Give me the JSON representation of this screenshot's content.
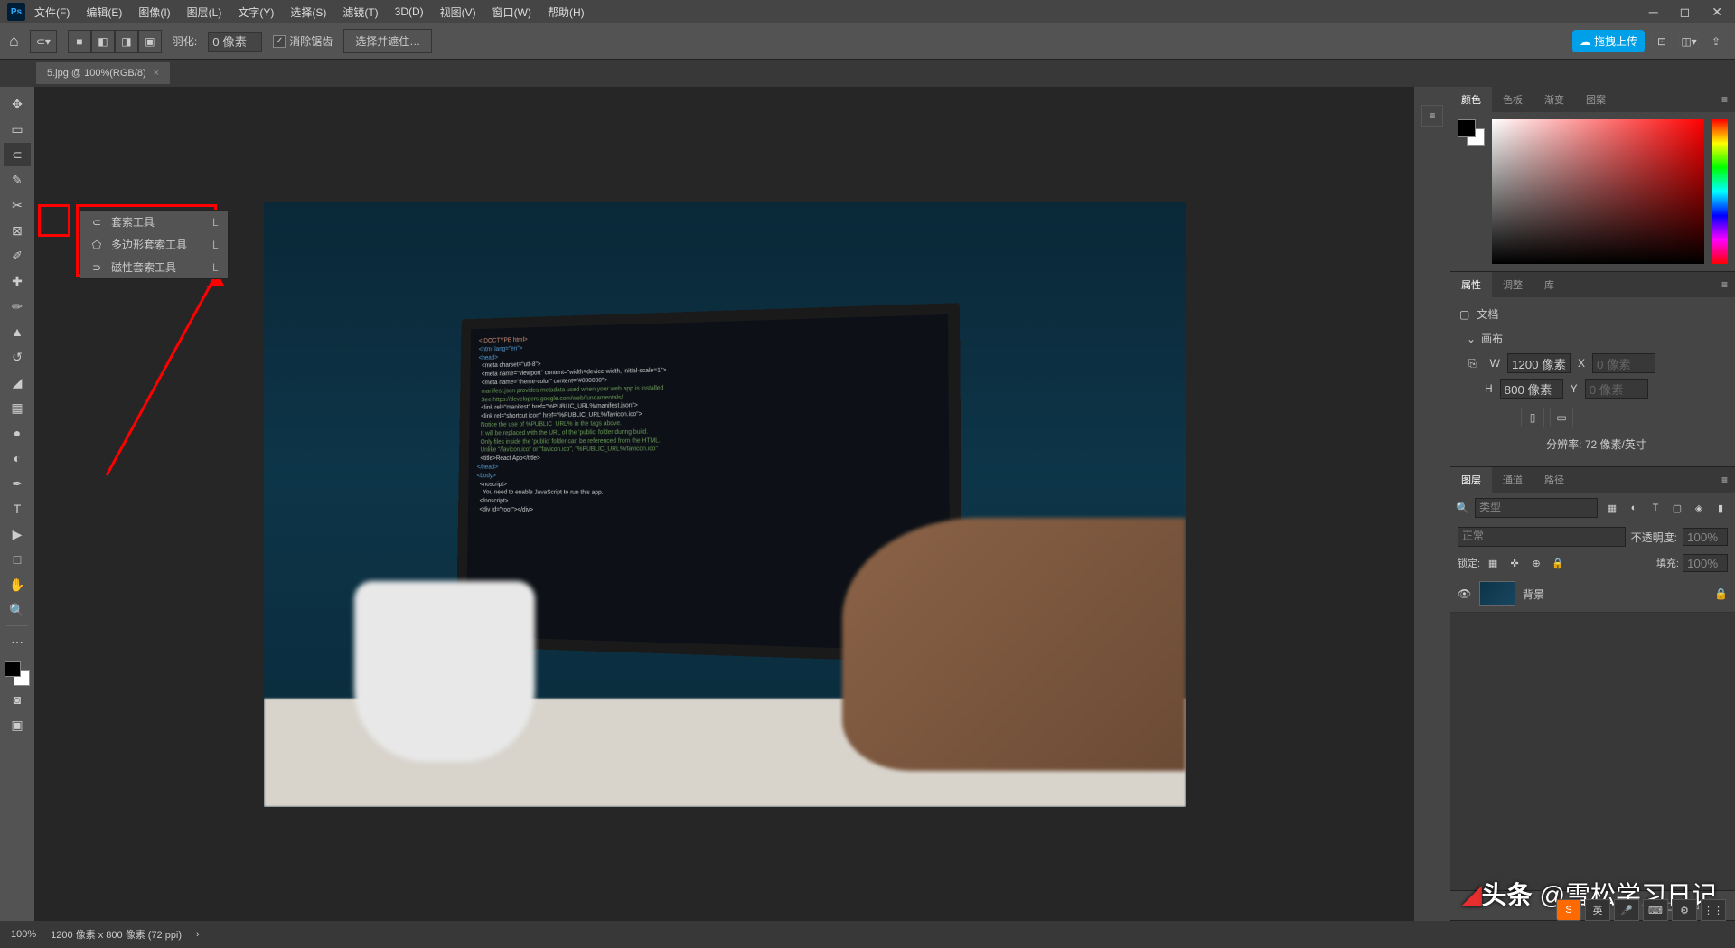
{
  "menu": {
    "file": "文件(F)",
    "edit": "编辑(E)",
    "image": "图像(I)",
    "layer": "图层(L)",
    "type": "文字(Y)",
    "select": "选择(S)",
    "filter": "滤镜(T)",
    "threeD": "3D(D)",
    "view": "视图(V)",
    "window": "窗口(W)",
    "help": "帮助(H)"
  },
  "options": {
    "feather_label": "羽化:",
    "feather_value": "0 像素",
    "antialias": "消除锯齿",
    "select_mask": "选择并遮住…",
    "upload": "拖拽上传"
  },
  "tab": {
    "title": "5.jpg @ 100%(RGB/8)"
  },
  "ctx": [
    {
      "icon": "⊂",
      "name": "套索工具",
      "key": "L"
    },
    {
      "icon": "⬠",
      "name": "多边形套索工具",
      "key": "L"
    },
    {
      "icon": "⊃",
      "name": "磁性套索工具",
      "key": "L"
    }
  ],
  "panels": {
    "color": {
      "tabs": [
        "颜色",
        "色板",
        "渐变",
        "图案"
      ]
    },
    "props": {
      "tabs": [
        "属性",
        "调整",
        "库"
      ],
      "doc": "文档",
      "canvas": "画布",
      "w_label": "W",
      "w_val": "1200 像素",
      "x_label": "X",
      "x_val": "0 像素",
      "h_label": "H",
      "h_val": "800 像素",
      "y_label": "Y",
      "y_val": "0 像素",
      "res": "分辨率: 72 像素/英寸"
    },
    "layers": {
      "tabs": [
        "图层",
        "通道",
        "路径"
      ],
      "search_ph": "类型",
      "blend": "正常",
      "opacity_label": "不透明度:",
      "opacity": "100%",
      "lock_label": "锁定:",
      "fill_label": "填充:",
      "fill": "100%",
      "layer_name": "背景"
    }
  },
  "status": {
    "zoom": "100%",
    "dims": "1200 像素 x 800 像素 (72 ppi)"
  },
  "watermark": {
    "brand": "头条",
    "handle": "@雪松学习日记"
  },
  "taskbar": {
    "ime": "英"
  }
}
